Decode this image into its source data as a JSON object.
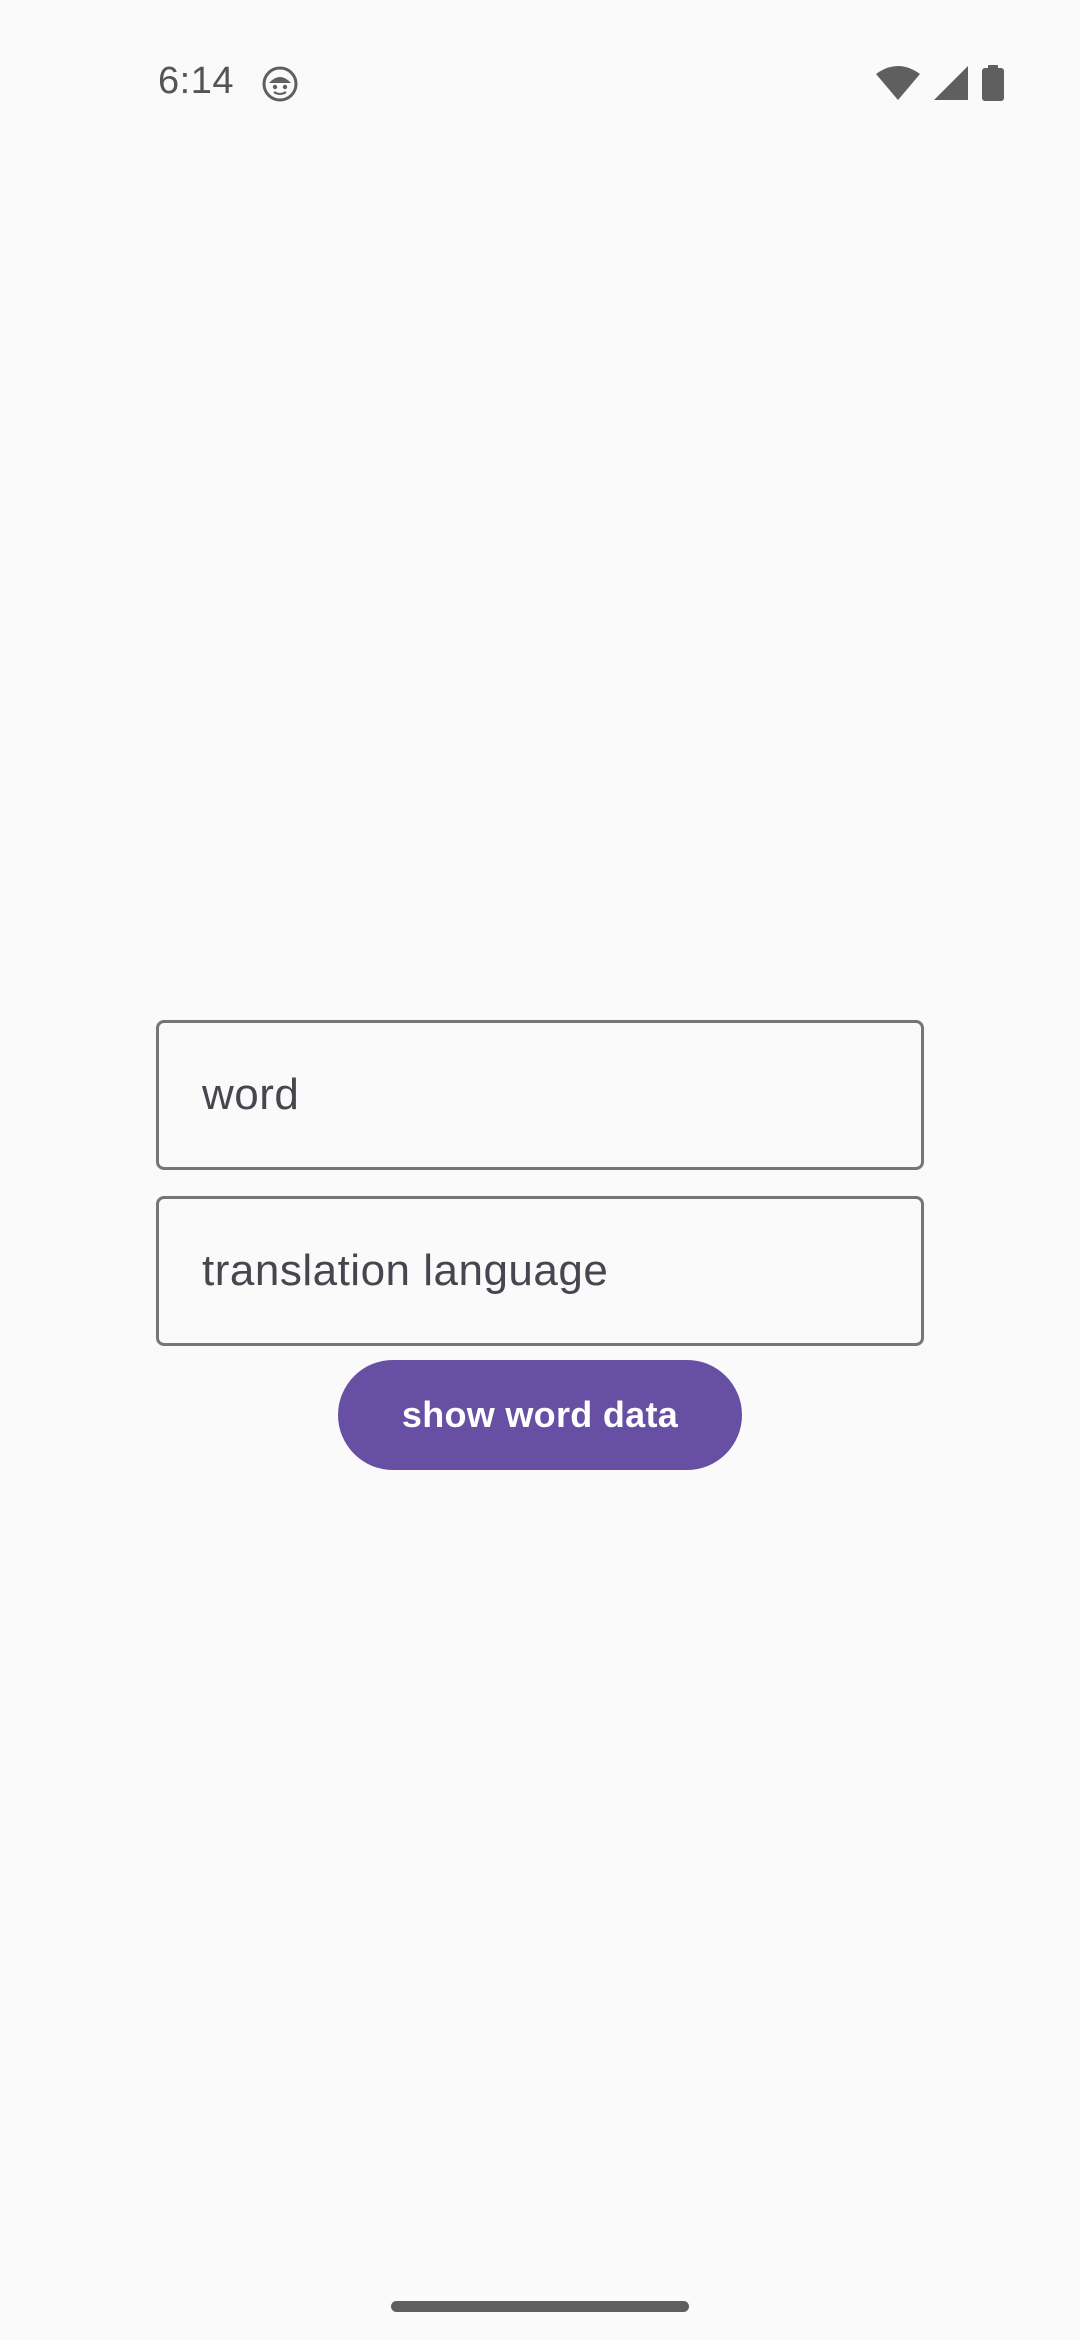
{
  "status_bar": {
    "time": "6:14",
    "app_icon": "android-face-icon",
    "icons": [
      "wifi-icon",
      "cellular-signal-icon",
      "battery-icon"
    ]
  },
  "form": {
    "word_placeholder": "word",
    "translation_placeholder": "translation language",
    "submit_label": "show word data"
  },
  "colors": {
    "background": "#fafafa",
    "primary": "#6750a4",
    "outline": "#767676",
    "placeholder_text": "#47464f",
    "status_icons": "#5f5f5f"
  }
}
